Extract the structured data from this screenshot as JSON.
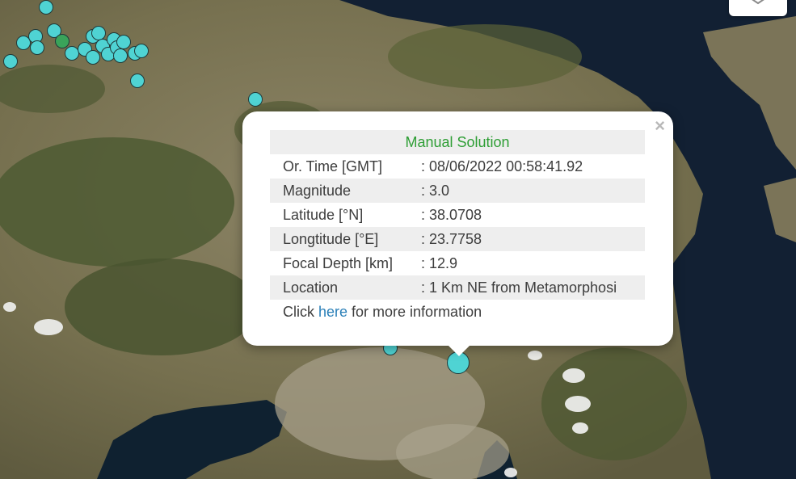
{
  "popup": {
    "title": "Manual Solution",
    "rows": [
      {
        "label": "Or. Time [GMT]",
        "value": ": 08/06/2022 00:58:41.92"
      },
      {
        "label": "Magnitude",
        "value": ": 3.0"
      },
      {
        "label": "Latitude [°N]",
        "value": ": 38.0708"
      },
      {
        "label": "Longtitude [°E]",
        "value": ": 23.7758"
      },
      {
        "label": "Focal Depth [km]",
        "value": ": 12.9"
      },
      {
        "label": "Location",
        "value": ": 1 Km NE from Metamorphosi"
      }
    ],
    "more": {
      "prefix": "Click ",
      "link": "here",
      "suffix": " for more information"
    },
    "close_symbol": "×"
  },
  "markers": {
    "color_cyan": "#4fd3d3",
    "color_green": "#3aa35a",
    "selected_label": "selected-event"
  },
  "icons": {
    "layers": "layers-icon",
    "close": "close-icon"
  }
}
